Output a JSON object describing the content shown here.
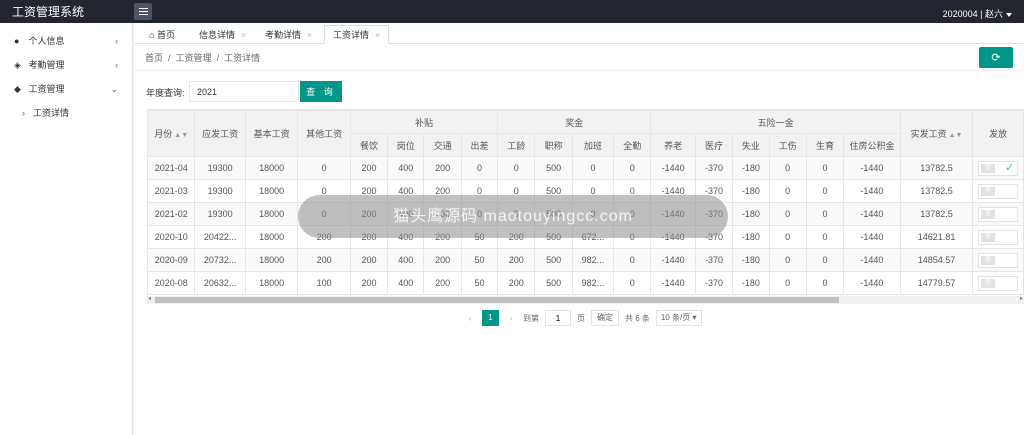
{
  "app": {
    "title": "工资管理系统",
    "user": "2020004 | 赵六"
  },
  "sidebar": {
    "items": [
      {
        "label": "个人信息",
        "icon": "user-icon"
      },
      {
        "label": "考勤管理",
        "icon": "layers-icon"
      },
      {
        "label": "工资管理",
        "icon": "tag-icon"
      }
    ],
    "sub_item": "工资详情"
  },
  "tabs": [
    "首页",
    "信息详情",
    "考勤详情",
    "工资详情"
  ],
  "breadcrumb": [
    "首页",
    "工资管理",
    "工资详情"
  ],
  "query": {
    "label": "年度查询:",
    "value": "2021",
    "button": "查 询"
  },
  "table": {
    "group_headers": {
      "subsidy": "补贴",
      "bonus": "奖金",
      "insurance": "五险一金"
    },
    "headers": {
      "month": "月份",
      "payable": "应发工资",
      "base": "基本工资",
      "other": "其他工资",
      "meal": "餐饮",
      "post": "岗位",
      "traffic": "交通",
      "travel": "出差",
      "seniority": "工龄",
      "title": "职称",
      "overtime": "加班",
      "attendance": "全勤",
      "pension": "养老",
      "medical": "医疗",
      "unemployment": "失业",
      "injury": "工伤",
      "maternity": "生育",
      "housing": "住房公积金",
      "actual": "实发工资",
      "issued": "发放"
    },
    "rows": [
      [
        "2021-04",
        "19300",
        "18000",
        "0",
        "200",
        "400",
        "200",
        "0",
        "0",
        "500",
        "0",
        "0",
        "-1440",
        "-370",
        "-180",
        "0",
        "0",
        "-1440",
        "13782.5"
      ],
      [
        "2021-03",
        "19300",
        "18000",
        "0",
        "200",
        "400",
        "200",
        "0",
        "0",
        "500",
        "0",
        "0",
        "-1440",
        "-370",
        "-180",
        "0",
        "0",
        "-1440",
        "13782.5"
      ],
      [
        "2021-02",
        "19300",
        "18000",
        "0",
        "200",
        "400",
        "200",
        "0",
        "0",
        "500",
        "0",
        "0",
        "-1440",
        "-370",
        "-180",
        "0",
        "0",
        "-1440",
        "13782.5"
      ],
      [
        "2020-10",
        "20422...",
        "18000",
        "200",
        "200",
        "400",
        "200",
        "50",
        "200",
        "500",
        "672...",
        "0",
        "-1440",
        "-370",
        "-180",
        "0",
        "0",
        "-1440",
        "14621.81"
      ],
      [
        "2020-09",
        "20732...",
        "18000",
        "200",
        "200",
        "400",
        "200",
        "50",
        "200",
        "500",
        "982...",
        "0",
        "-1440",
        "-370",
        "-180",
        "0",
        "0",
        "-1440",
        "14854.57"
      ],
      [
        "2020-08",
        "20632...",
        "18000",
        "100",
        "200",
        "400",
        "200",
        "50",
        "200",
        "500",
        "982...",
        "0",
        "-1440",
        "-370",
        "-180",
        "0",
        "0",
        "-1440",
        "14779.57"
      ]
    ],
    "toggle_label": "是"
  },
  "pager": {
    "current": "1",
    "goto_label": "到第",
    "goto_value": "1",
    "page_unit": "页",
    "confirm": "确定",
    "total": "共 6 条",
    "size": "10 条/页"
  },
  "watermark": "猫头鹰源码 maotouyingcc.com",
  "colors": {
    "accent": "#009688",
    "topbar": "#23262e"
  }
}
